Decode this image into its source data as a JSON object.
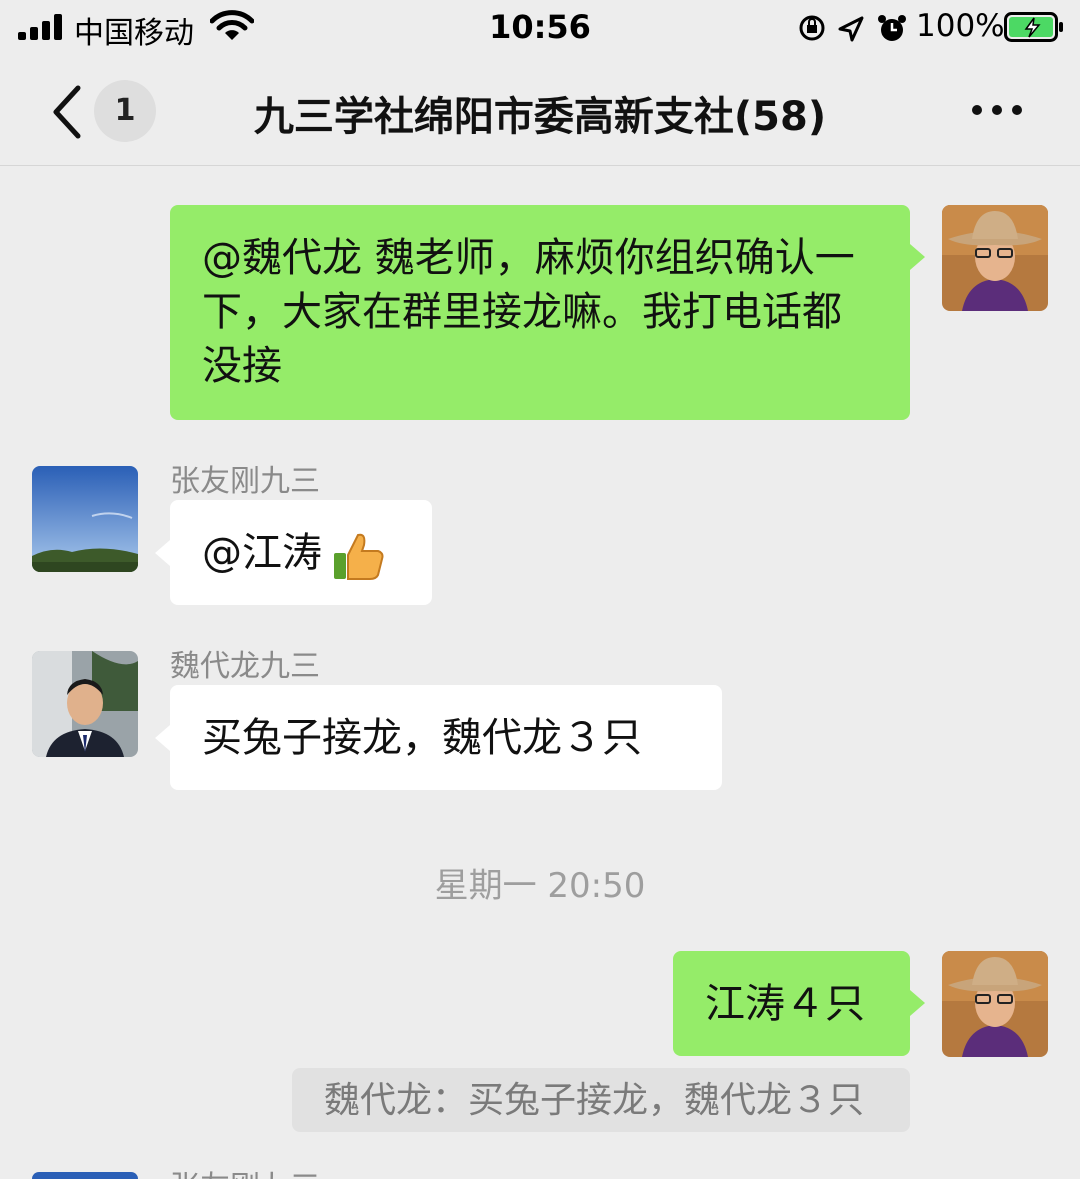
{
  "status_bar": {
    "carrier": "中国移动",
    "time": "10:56",
    "battery_percent": "100%",
    "icons": [
      "signal-icon",
      "wifi-icon",
      "orientation-lock-icon",
      "location-arrow-icon",
      "alarm-icon",
      "battery-charging-icon"
    ]
  },
  "nav": {
    "unread_count": "1",
    "title": "九三学社绵阳市委高新支社(58)",
    "back_icon": "chevron-left-icon",
    "more_icon": "ellipsis-icon"
  },
  "messages": [
    {
      "side": "me",
      "text": "@魏代龙 魏老师，麻烦你组织确认一下，大家在群里接龙嘛。我打电话都没接"
    },
    {
      "side": "them",
      "sender": "张友刚九三",
      "text": "@江涛",
      "emoji": "thumbs-up-icon"
    },
    {
      "side": "them",
      "sender": "魏代龙九三",
      "text": "买兔子接龙，魏代龙３只"
    },
    {
      "type": "timestamp",
      "text": "星期一 20:50"
    },
    {
      "side": "me",
      "text": "江涛４只",
      "quote": "魏代龙：买兔子接龙，魏代龙３只"
    },
    {
      "side": "them",
      "sender": "张友刚九三"
    }
  ],
  "colors": {
    "background": "#ededed",
    "my_bubble": "#95ec69",
    "their_bubble": "#ffffff",
    "battery": "#4cd964"
  }
}
